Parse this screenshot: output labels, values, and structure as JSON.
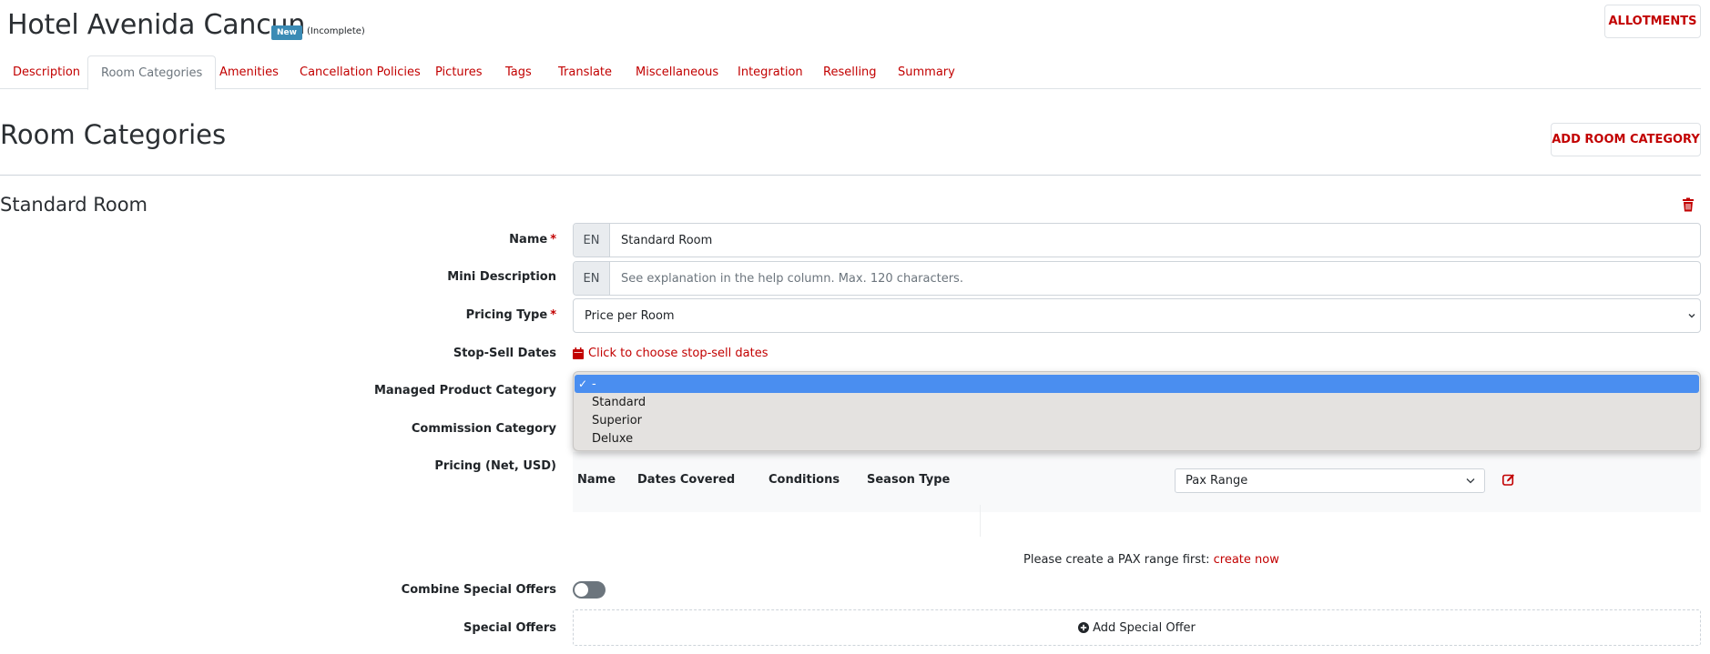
{
  "header": {
    "hotel_name": "Hotel Avenida Cancun",
    "badge": "New",
    "status_note": "(Incomplete)",
    "allotments_label": "ALLOTMENTS"
  },
  "tabs": [
    {
      "label": "Description"
    },
    {
      "label": "Room Categories",
      "active": true
    },
    {
      "label": "Amenities"
    },
    {
      "label": "Cancellation Policies"
    },
    {
      "label": "Pictures"
    },
    {
      "label": "Tags"
    },
    {
      "label": "Translate"
    },
    {
      "label": "Miscellaneous"
    },
    {
      "label": "Integration"
    },
    {
      "label": "Reselling"
    },
    {
      "label": "Summary"
    }
  ],
  "page": {
    "title": "Room Categories",
    "add_button": "ADD ROOM CATEGORY"
  },
  "room": {
    "title": "Standard Room",
    "fields": {
      "name_label": "Name",
      "name_lang": "EN",
      "name_value": "Standard Room",
      "mini_desc_label": "Mini Description",
      "mini_desc_lang": "EN",
      "mini_desc_placeholder": "See explanation in the help column. Max. 120 characters.",
      "pricing_type_label": "Pricing Type",
      "pricing_type_value": "Price per Room",
      "stop_sell_label": "Stop-Sell Dates",
      "stop_sell_link": "Click to choose stop-sell dates",
      "managed_category_label": "Managed Product Category",
      "commission_category_label": "Commission Category",
      "pricing_label": "Pricing (Net, USD)",
      "combine_offers_label": "Combine Special Offers",
      "special_offers_label": "Special Offers"
    },
    "dropdown": {
      "options": [
        {
          "label": "-",
          "selected": true
        },
        {
          "label": "Standard"
        },
        {
          "label": "Superior"
        },
        {
          "label": "Deluxe"
        }
      ]
    },
    "pricing_table": {
      "columns": [
        "Name",
        "Dates Covered",
        "Conditions",
        "Season Type"
      ],
      "pax_select": "Pax Range",
      "empty_msg": "Please create a PAX range first:",
      "create_link": "create now"
    },
    "combine_offers_on": false,
    "add_special_offer": "Add Special Offer"
  },
  "colors": {
    "accent": "#c20000",
    "badge": "#3b8bb5",
    "dropdown_selected": "#4a8ef0"
  }
}
